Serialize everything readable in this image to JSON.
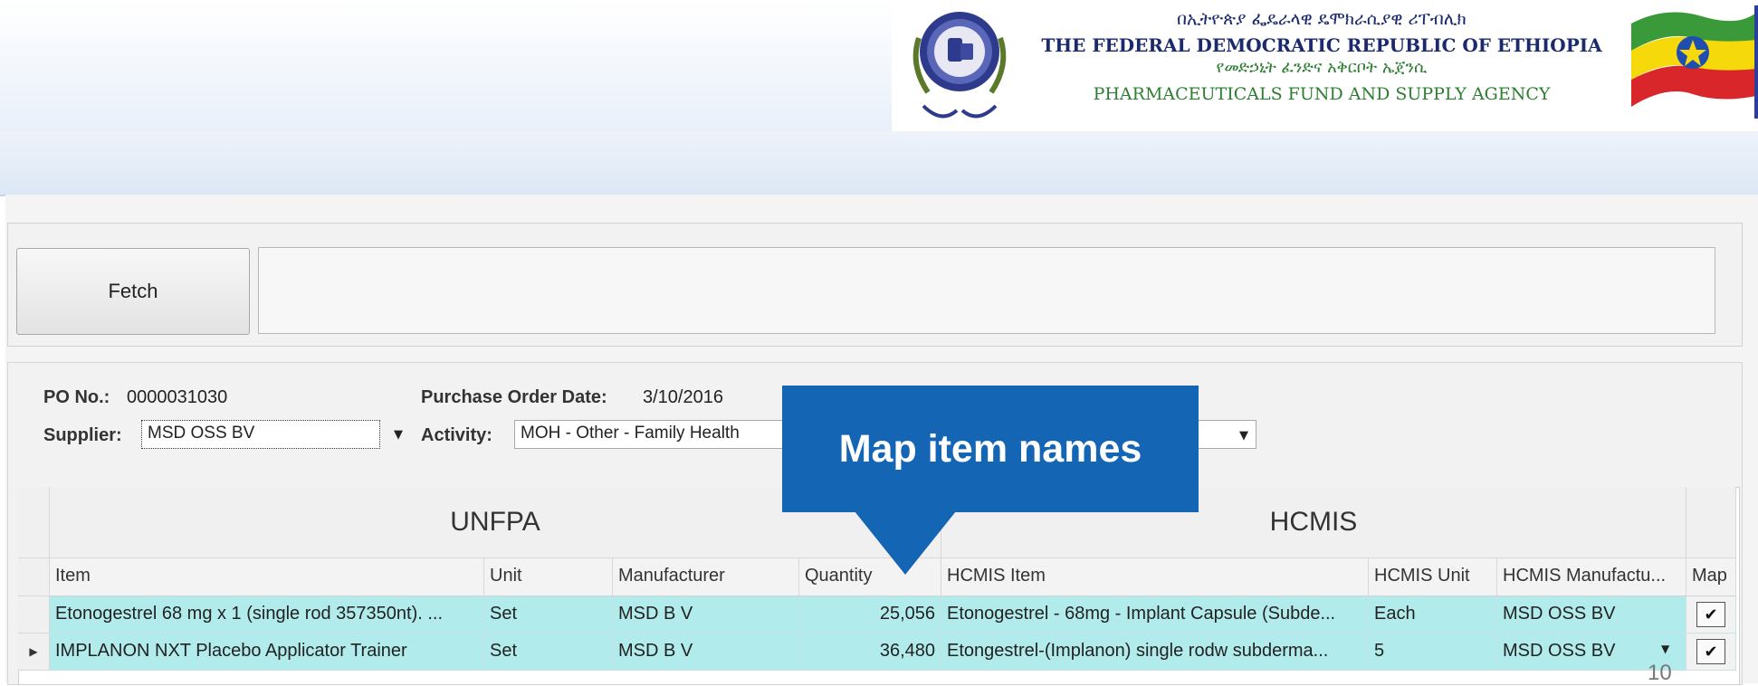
{
  "header": {
    "amharic_line1": "በኢትዮጵያ ፌዴራላዊ ዴሞክራሲያዊ ሪፐብሊክ",
    "english_line1": "THE FEDERAL DEMOCRATIC REPUBLIC OF ETHIOPIA",
    "amharic_line2": "የመድኃኒት ፈንድና አቅርቦት ኤጀንሲ",
    "english_line2": "PHARMACEUTICALS FUND AND SUPPLY AGENCY"
  },
  "fetch": {
    "button_label": "Fetch"
  },
  "po": {
    "po_no_label": "PO No.:",
    "po_no_value": "0000031030",
    "date_label": "Purchase Order Date:",
    "date_value": "3/10/2016",
    "supplier_label": "Supplier:",
    "supplier_value": "MSD OSS BV",
    "activity_label": "Activity:",
    "activity_value": "MOH - Other - Family Health"
  },
  "callout": {
    "text": "Map item names"
  },
  "grid": {
    "group_unfpa": "UNFPA",
    "group_hcmis": "HCMIS",
    "columns": [
      "Item",
      "Unit",
      "Manufacturer",
      "Quantity",
      "HCMIS Item",
      "HCMIS Unit",
      "HCMIS Manufactu...",
      "Map"
    ],
    "rows": [
      {
        "item": "Etonogestrel 68 mg x 1 (single rod 357350nt). ...",
        "unit": "Set",
        "manufacturer": "MSD B V",
        "quantity": "25,056",
        "hcmis_item": "Etonogestrel - 68mg - Implant Capsule (Subde...",
        "hcmis_unit": "Each",
        "hcmis_manufacturer": "MSD OSS BV",
        "map_checked": true
      },
      {
        "item": "IMPLANON NXT Placebo Applicator Trainer",
        "unit": "Set",
        "manufacturer": "MSD B V",
        "quantity": "36,480",
        "hcmis_item": "Etongestrel-(Implanon)  single rodw subderma...",
        "hcmis_unit": "5",
        "hcmis_manufacturer": "MSD OSS BV",
        "map_checked": true
      }
    ]
  },
  "page_number": "10",
  "colors": {
    "callout": "#1565b5",
    "row_highlight": "#b2ebec"
  }
}
